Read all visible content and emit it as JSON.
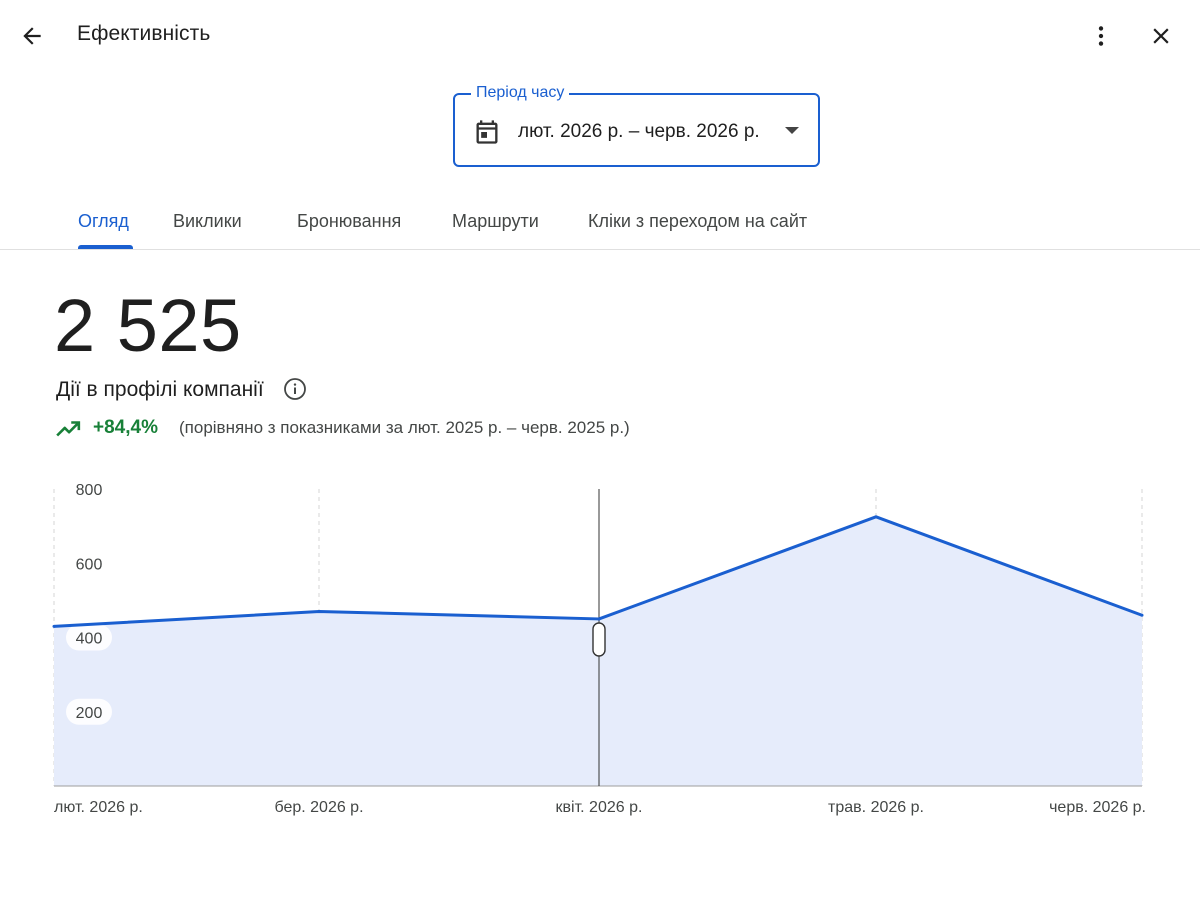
{
  "header": {
    "title": "Ефективність",
    "back_icon": "arrow-back-icon",
    "more_icon": "more-vert-icon",
    "close_icon": "close-icon"
  },
  "period": {
    "label": "Період часу",
    "value": "лют. 2026 р. – черв. 2026 р.",
    "icon": "calendar-icon"
  },
  "tabs": [
    {
      "label": "Огляд",
      "active": true
    },
    {
      "label": "Виклики",
      "active": false
    },
    {
      "label": "Бронювання",
      "active": false
    },
    {
      "label": "Маршрути",
      "active": false
    },
    {
      "label": "Кліки з переходом на сайт",
      "active": false
    }
  ],
  "summary": {
    "total": "2 525",
    "label": "Дії в профілі компанії",
    "trend_value": "+84,4%",
    "trend_compare": "(порівняно з показниками за лют. 2025 р. – черв. 2025 р.)",
    "trend_color": "#188038"
  },
  "colors": {
    "accent": "#1a5fd0",
    "line": "#1a5fd0",
    "area": "#e6ecfb"
  },
  "chart_data": {
    "type": "area",
    "categories": [
      "лют. 2026 р.",
      "бер. 2026 р.",
      "квіт. 2026 р.",
      "трав. 2026 р.",
      "черв. 2026 р."
    ],
    "values": [
      430,
      470,
      450,
      725,
      460
    ],
    "yticks": [
      "800",
      "600",
      "400",
      "200"
    ],
    "ylim": [
      0,
      800
    ],
    "grid": "vertical dashed",
    "selected_category": "квіт. 2026 р."
  }
}
